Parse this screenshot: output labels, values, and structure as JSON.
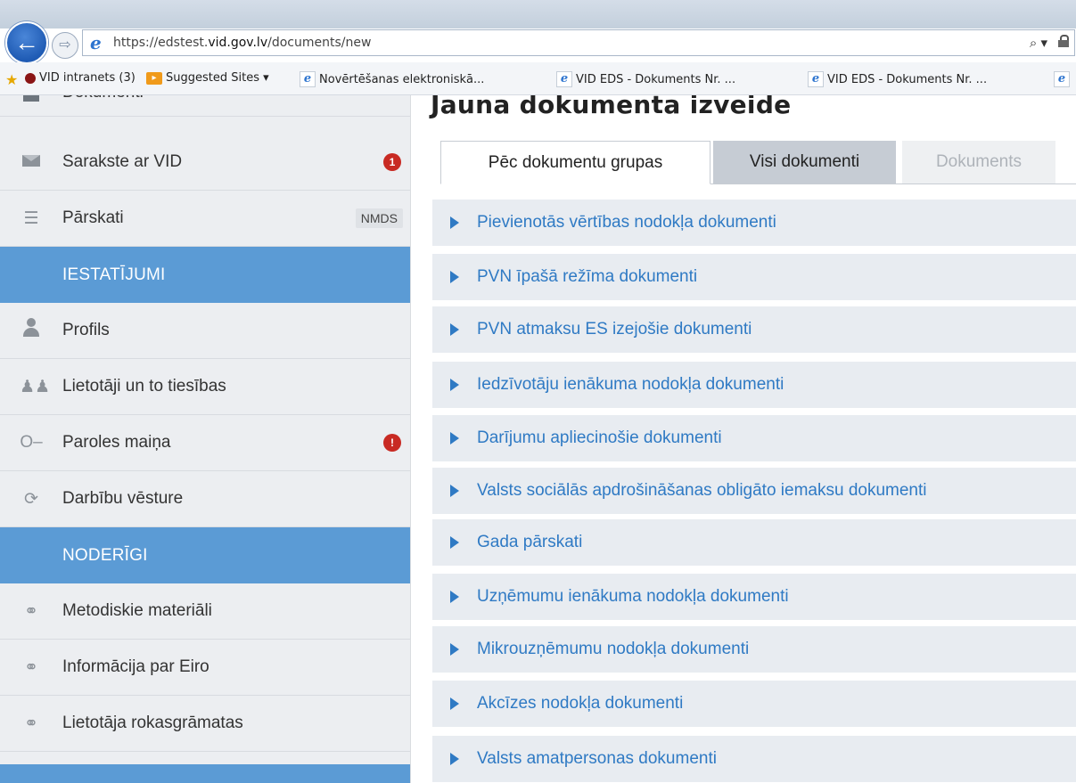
{
  "browser": {
    "url_prefix": "https://edstest.",
    "url_domain": "vid.gov.lv",
    "url_path": "/documents/new",
    "search_glyph": "⌕ ▾",
    "back_glyph": "←",
    "forward_glyph": "⇨",
    "favorites": [
      {
        "label": "VID intranets (3)",
        "icon": "red-dot-icon"
      },
      {
        "label": "Suggested Sites ▾",
        "icon": "suggested-sites-icon"
      },
      {
        "label": "Novērtēšanas elektroniskā...",
        "icon": "ie-page-icon"
      },
      {
        "label": "VID EDS - Dokuments Nr. ...",
        "icon": "ie-page-icon"
      },
      {
        "label": "VID EDS - Dokuments Nr. ...",
        "icon": "ie-page-icon"
      }
    ]
  },
  "sidebar": {
    "items": [
      {
        "label": "Dokumenti",
        "icon": "document-icon"
      },
      {
        "label": "Sarakste ar VID",
        "icon": "envelope-icon",
        "badge": "1"
      },
      {
        "label": "Pārskati",
        "icon": "reports-icon",
        "badge": "NMDS"
      }
    ],
    "section_settings": "IESTATĪJUMI",
    "settings_items": [
      {
        "label": "Profils",
        "icon": "person-icon"
      },
      {
        "label": "Lietotāji un to tiesības",
        "icon": "users-icon"
      },
      {
        "label": "Paroles maiņa",
        "icon": "key-icon",
        "badge": "!"
      },
      {
        "label": "Darbību vēsture",
        "icon": "history-icon"
      }
    ],
    "section_useful": "NODERĪGI",
    "useful_items": [
      {
        "label": "Metodiskie materiāli",
        "icon": "link-icon"
      },
      {
        "label": "Informācija par Eiro",
        "icon": "link-icon"
      },
      {
        "label": "Lietotāja rokasgrāmatas",
        "icon": "link-icon"
      }
    ]
  },
  "main": {
    "title": "Jauna dokumenta izveide",
    "tabs": [
      {
        "label": "Pēc dokumentu grupas",
        "state": "active"
      },
      {
        "label": "Visi dokumenti",
        "state": "inactive"
      },
      {
        "label": "Dokuments",
        "state": "disabled"
      }
    ],
    "groups": [
      "Pievienotās vērtības nodokļa dokumenti",
      "PVN īpašā režīma dokumenti",
      "PVN atmaksu ES izejošie dokumenti",
      "Iedzīvotāju ienākuma nodokļa dokumenti",
      "Darījumu apliecinošie dokumenti",
      "Valsts sociālās apdrošināšanas obligāto iemaksu dokumenti",
      "Gada pārskati",
      "Uzņēmumu ienākuma nodokļa dokumenti",
      "Mikrouzņēmumu nodokļa dokumenti",
      "Akcīzes nodokļa dokumenti",
      "Valsts amatpersonas dokumenti"
    ]
  },
  "colors": {
    "section_bg": "#5b9bd5",
    "accordion_bg": "#e8ecf1",
    "link_text": "#2f7ac4",
    "badge_red": "#c82a23"
  }
}
